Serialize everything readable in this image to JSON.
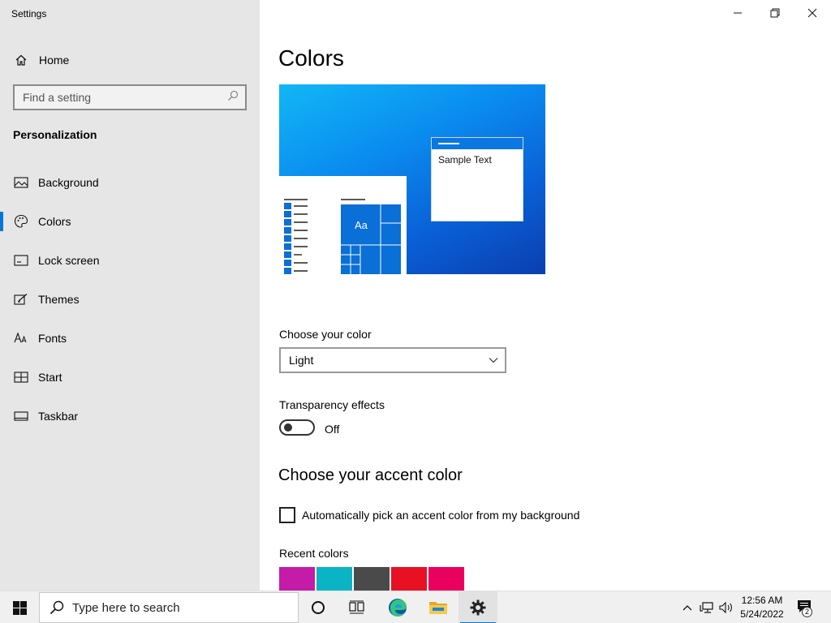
{
  "window": {
    "title": "Settings",
    "controls": {
      "minimize": "minimize",
      "restore": "restore",
      "close": "close"
    }
  },
  "sidebar": {
    "home_label": "Home",
    "search_placeholder": "Find a setting",
    "section_title": "Personalization",
    "items": [
      {
        "label": "Background",
        "icon": "image-icon",
        "active": false
      },
      {
        "label": "Colors",
        "icon": "palette-icon",
        "active": true
      },
      {
        "label": "Lock screen",
        "icon": "lock-screen-icon",
        "active": false
      },
      {
        "label": "Themes",
        "icon": "brush-icon",
        "active": false
      },
      {
        "label": "Fonts",
        "icon": "font-icon",
        "active": false
      },
      {
        "label": "Start",
        "icon": "start-layout-icon",
        "active": false
      },
      {
        "label": "Taskbar",
        "icon": "taskbar-icon",
        "active": false
      }
    ],
    "accent": "#0078d7"
  },
  "main": {
    "title": "Colors",
    "preview": {
      "sample_text": "Sample Text",
      "tile_text": "Aa"
    },
    "choose_color": {
      "label": "Choose your color",
      "value": "Light"
    },
    "transparency": {
      "label": "Transparency effects",
      "state": "Off",
      "on": false
    },
    "accent_heading": "Choose your accent color",
    "auto_pick": {
      "label": "Automatically pick an accent color from my background",
      "checked": false
    },
    "recent_colors": {
      "label": "Recent colors",
      "colors": [
        "#c41ba8",
        "#0ab4c4",
        "#4a4a4a",
        "#e81123",
        "#ea005e"
      ]
    }
  },
  "taskbar": {
    "search_placeholder": "Type here to search",
    "pinned": [
      "cortana-icon",
      "task-view-icon",
      "edge-icon",
      "file-explorer-icon",
      "settings-icon"
    ],
    "clock": {
      "time": "12:56 AM",
      "date": "5/24/2022"
    },
    "notification_count": "2"
  }
}
